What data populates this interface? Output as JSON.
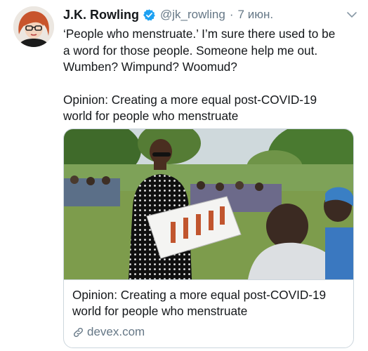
{
  "author": {
    "name": "J.K. Rowling",
    "handle": "@jk_rowling",
    "separator": "·",
    "time": "7 июн."
  },
  "tweet": {
    "line1": "‘People who menstruate.’ I’m sure there used to be\na word for those people. Someone help me out.\nWumben? Wimpund? Woomud?",
    "line2": "Opinion: Creating a more equal post-COVID-19\nworld for people who menstruate"
  },
  "card": {
    "title": "Opinion: Creating a more equal post-COVID-19\nworld for people who menstruate",
    "domain": "devex.com"
  },
  "colors": {
    "verified": "#1da1f2",
    "secondary_text": "#657786",
    "border": "#ccd6dd"
  },
  "icons": {
    "verified": "verified-badge-icon",
    "menu": "chevron-down-icon",
    "link": "link-icon"
  }
}
